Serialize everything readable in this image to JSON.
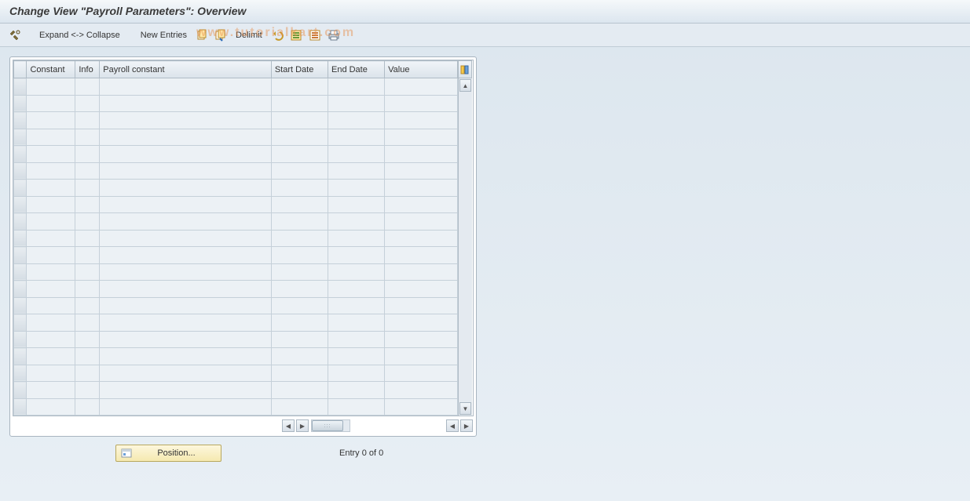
{
  "title": "Change View \"Payroll Parameters\": Overview",
  "toolbar": {
    "expand_collapse": "Expand <-> Collapse",
    "new_entries": "New Entries",
    "delimit": "Delimit"
  },
  "watermark": "www.tutorialkart.com",
  "table": {
    "columns": {
      "constant": "Constant",
      "info": "Info",
      "payroll_constant": "Payroll constant",
      "start_date": "Start Date",
      "end_date": "End Date",
      "value": "Value"
    },
    "row_count": 20,
    "rows": []
  },
  "footer": {
    "position_label": "Position...",
    "entry_text": "Entry 0 of 0"
  }
}
